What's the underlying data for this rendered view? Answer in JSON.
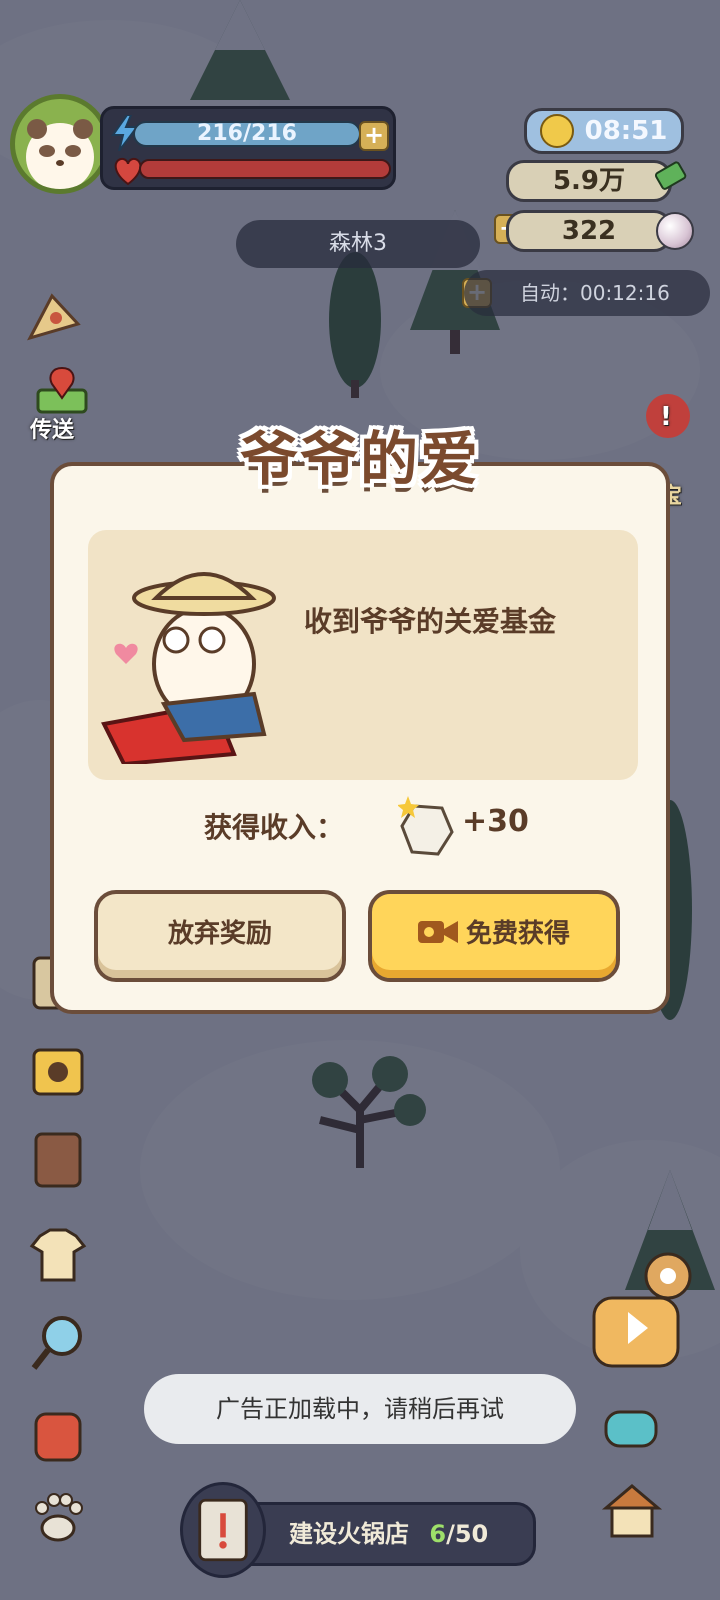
{
  "hud": {
    "energy": "216/216",
    "plus": "+",
    "time": "08:51",
    "money": "5.9万",
    "pearls": "322",
    "location": "森林3",
    "auto_label": "自动：00:12:16"
  },
  "side": {
    "teleport_label": "传送",
    "treasure_label_fragment": "宝",
    "notice_mark": "!"
  },
  "dialog": {
    "title": "爷爷的爱",
    "message": "收到爷爷的关爱基金",
    "income_label": "获得收入：",
    "income_value": "+30",
    "abandon_label": "放弃奖励",
    "free_label": "免费获得"
  },
  "toast": {
    "message": "广告正加载中，请稍后再试"
  },
  "bottom": {
    "build_label": "建设火锅店",
    "build_count": "6",
    "build_total": "/50"
  },
  "colors": {
    "dialog_border": "#6b4d3a",
    "free_button": "#ffd55a",
    "abandon_button": "#f3e6c8",
    "title_brown": "#7b4a2e"
  }
}
